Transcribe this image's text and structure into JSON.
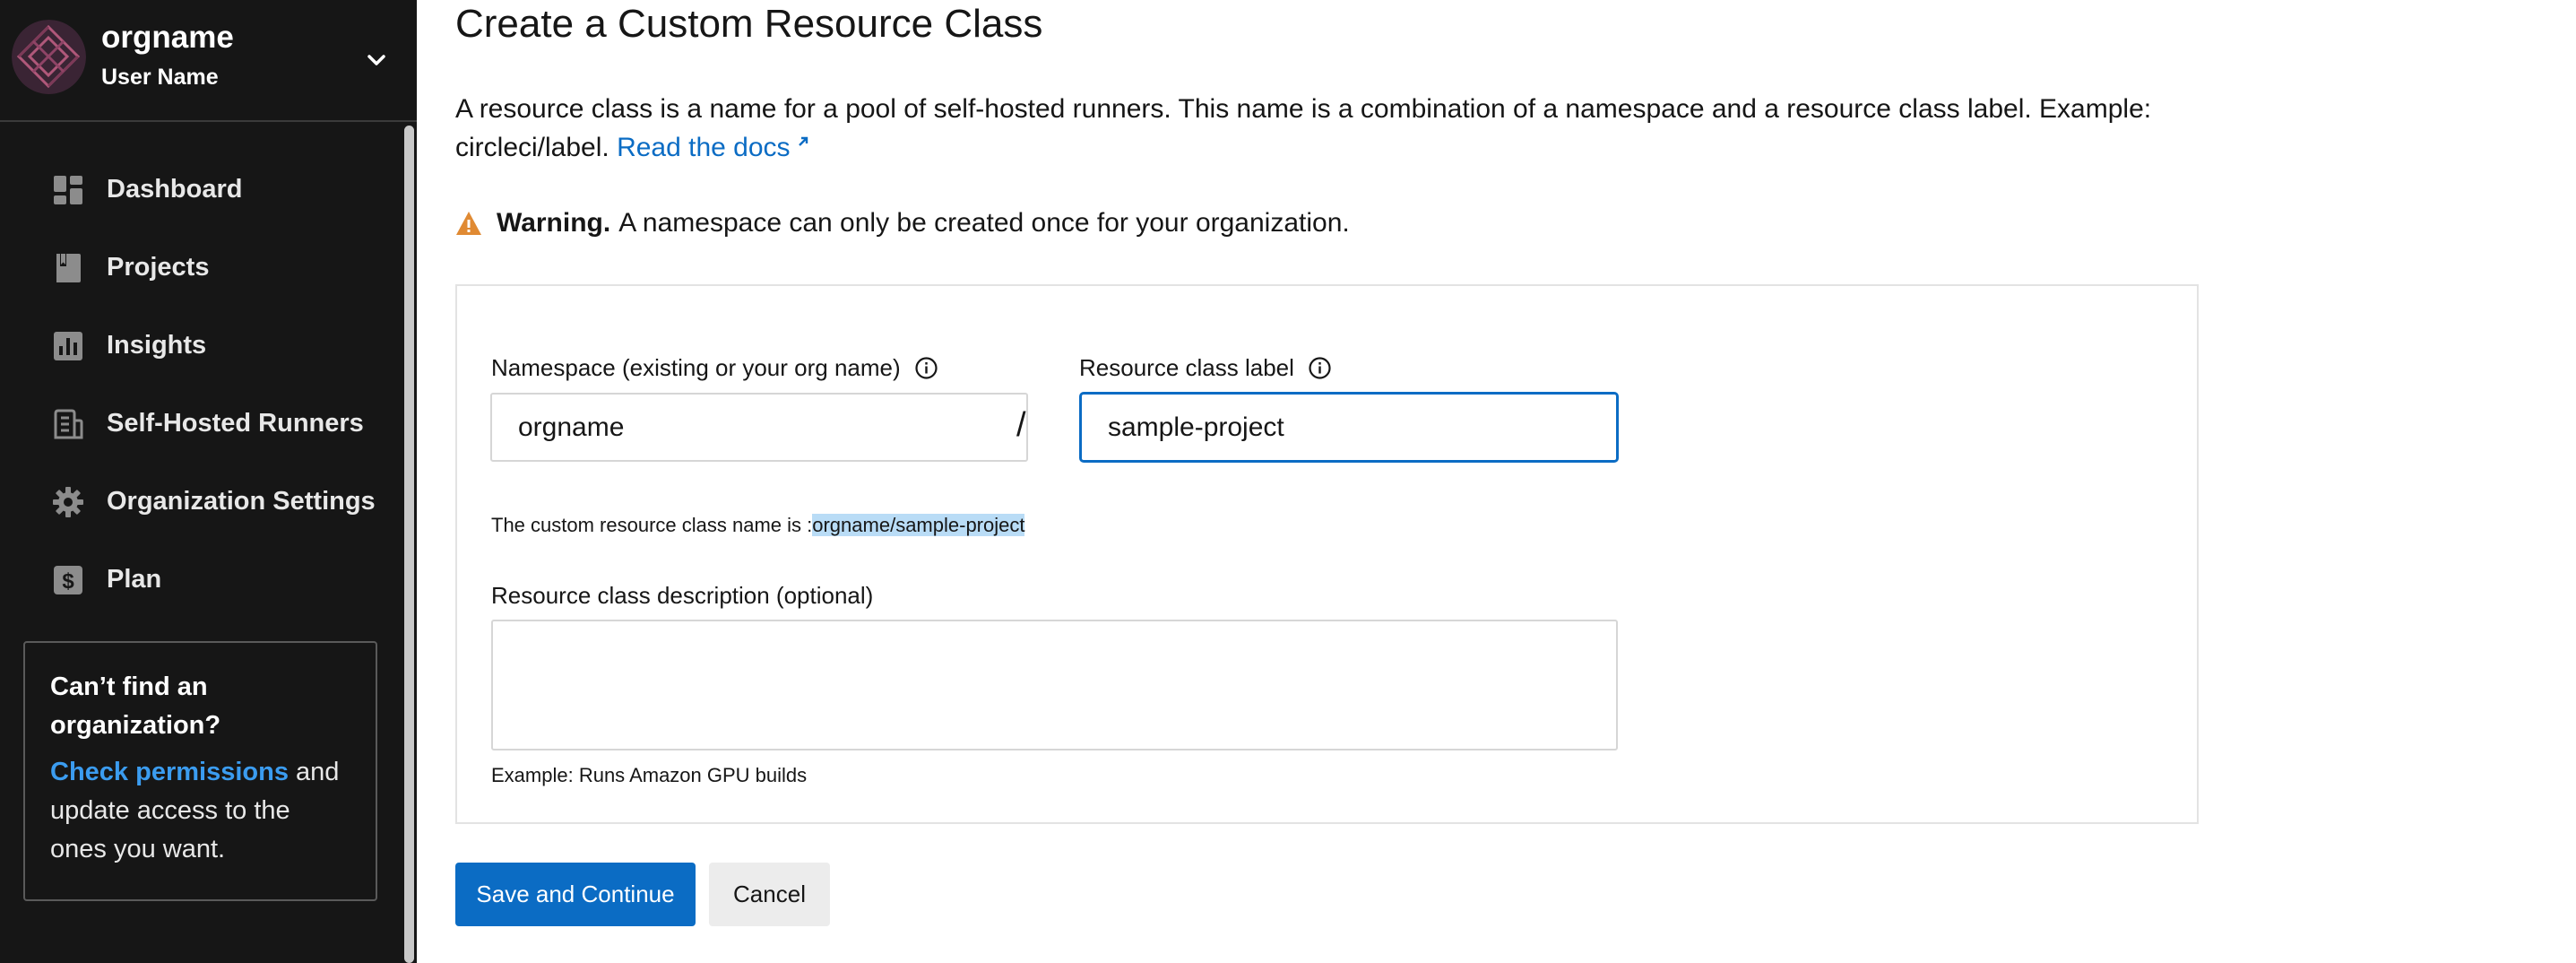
{
  "org": {
    "name": "orgname",
    "user": "User Name"
  },
  "sidebar": {
    "items": [
      {
        "label": "Dashboard",
        "icon": "dashboard-icon"
      },
      {
        "label": "Projects",
        "icon": "projects-icon"
      },
      {
        "label": "Insights",
        "icon": "insights-icon"
      },
      {
        "label": "Self-Hosted Runners",
        "icon": "runners-icon"
      },
      {
        "label": "Organization Settings",
        "icon": "gear-icon"
      },
      {
        "label": "Plan",
        "icon": "dollar-icon"
      }
    ],
    "help": {
      "title": "Can’t find an organization?",
      "link": "Check permissions",
      "text": " and update access to the ones you want."
    }
  },
  "page": {
    "title": "Create a Custom Resource Class",
    "intro": "A resource class is a name for a pool of self-hosted runners. This name is a combination of a namespace and a resource class label. Example: circleci/label.",
    "docs_link": "Read the docs",
    "warning_strong": "Warning.",
    "warning_text": "A namespace can only be created once for your organization."
  },
  "form": {
    "namespace_label": "Namespace (existing or your org name)",
    "namespace_value": "orgname",
    "separator": "/",
    "label_label": "Resource class label",
    "label_value": "sample-project",
    "result_prefix": "The custom resource class name is :",
    "result_name": "orgname/sample-project",
    "description_label": "Resource class description (optional)",
    "description_value": "",
    "description_hint": "Example: Runs Amazon GPU builds"
  },
  "actions": {
    "save": "Save and Continue",
    "cancel": "Cancel"
  },
  "colors": {
    "sidebar_bg": "#161616",
    "accent": "#0b6cc4",
    "link_sidebar": "#3b9cf0",
    "warning": "#e08a33",
    "highlight": "#b9dcf6"
  }
}
